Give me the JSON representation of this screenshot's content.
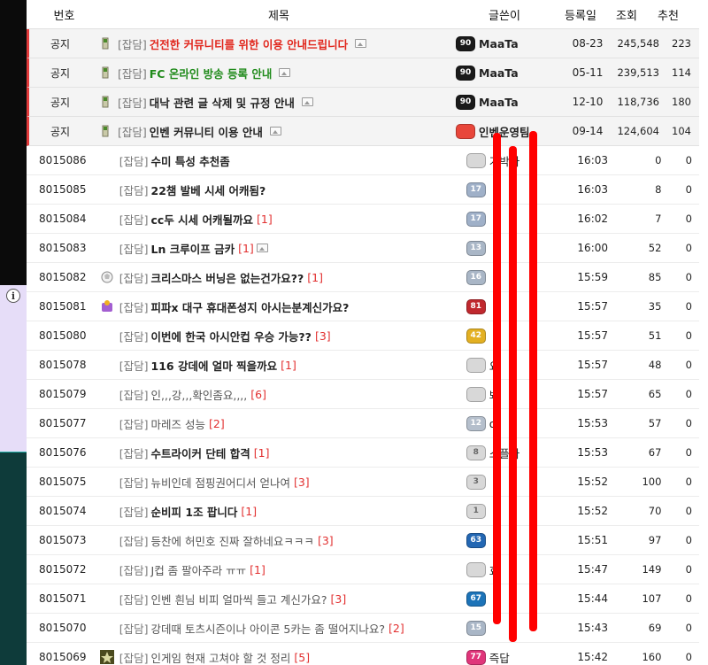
{
  "header": {
    "num": "번호",
    "title": "제목",
    "author": "글쓴이",
    "date": "등록일",
    "views": "조회",
    "recommend": "추천"
  },
  "tag": "[잡담]",
  "notices": [
    {
      "num": "공지",
      "title": "건전한 커뮤니티를 위한 이용 안내드립니다",
      "style": "red",
      "image": true,
      "author": "MaaTa",
      "level": "90",
      "level_color": "#1a1a1a",
      "date": "08-23",
      "views": "245,548",
      "rec": "223"
    },
    {
      "num": "공지",
      "title": "FC 온라인 방송 등록 안내",
      "style": "green",
      "image": true,
      "author": "MaaTa",
      "level": "90",
      "level_color": "#1a1a1a",
      "date": "05-11",
      "views": "239,513",
      "rec": "114"
    },
    {
      "num": "공지",
      "title": "대낙 관련 글 삭제 및 규정 안내",
      "style": "bold",
      "image": true,
      "author": "MaaTa",
      "level": "90",
      "level_color": "#1a1a1a",
      "date": "12-10",
      "views": "118,736",
      "rec": "180"
    },
    {
      "num": "공지",
      "title": "인벤 커뮤니티 이용 안내",
      "style": "bold",
      "image": true,
      "author": "인벤운영팀",
      "level": "",
      "level_color": "#e8463a",
      "date": "09-14",
      "views": "124,604",
      "rec": "104"
    }
  ],
  "posts": [
    {
      "num": "8015086",
      "title": "수미 특성 추천좀",
      "comments": "",
      "image": false,
      "style": "bold",
      "author": "기박사",
      "level": "",
      "level_color": "#d8d8d8",
      "date": "16:03",
      "views": "0",
      "rec": "0"
    },
    {
      "num": "8015085",
      "title": "22챔 발베 시세 어캐됨?",
      "comments": "",
      "image": false,
      "style": "bold",
      "author": "",
      "level": "17",
      "level_color": "#9fb0c8",
      "date": "16:03",
      "views": "8",
      "rec": "0"
    },
    {
      "num": "8015084",
      "title": "cc두 시세 어캐될까요",
      "comments": "[1]",
      "image": false,
      "style": "bold",
      "author": "",
      "level": "17",
      "level_color": "#9fb0c8",
      "date": "16:02",
      "views": "7",
      "rec": "0"
    },
    {
      "num": "8015083",
      "title": "Ln 크루이프 금카",
      "comments": "[1]",
      "image": true,
      "style": "bold",
      "author": "",
      "level": "13",
      "level_color": "#a9b6c6",
      "date": "16:00",
      "views": "52",
      "rec": "0"
    },
    {
      "num": "8015082",
      "title": "크리스마스 버닝은 없는건가요??",
      "comments": "[1]",
      "image": false,
      "style": "bold",
      "author": "",
      "level": "16",
      "level_color": "#a9b6c6",
      "date": "15:59",
      "views": "85",
      "rec": "0",
      "icon": "ball"
    },
    {
      "num": "8015081",
      "title": "피파x 대구 휴대폰성지 아시는분계신가요?",
      "comments": "",
      "image": false,
      "style": "bold",
      "author": "",
      "level": "81",
      "level_color": "#c0282e",
      "date": "15:57",
      "views": "35",
      "rec": "0",
      "icon": "purple"
    },
    {
      "num": "8015080",
      "title": "이번에 한국 아시안컵 우승 가능??",
      "comments": "[3]",
      "image": false,
      "style": "bold",
      "author": "",
      "level": "42",
      "level_color": "#e3b022",
      "date": "15:57",
      "views": "51",
      "rec": "0"
    },
    {
      "num": "8015078",
      "title": "116 강데에 얼마 찍을까요",
      "comments": "[1]",
      "image": false,
      "style": "bold",
      "author": "요",
      "level": "",
      "level_color": "#d8d8d8",
      "date": "15:57",
      "views": "48",
      "rec": "0"
    },
    {
      "num": "8015079",
      "title": "인,,,강,,,확인좀요,,,,",
      "comments": "[6]",
      "image": false,
      "style": "gray",
      "author": "봐",
      "level": "",
      "level_color": "#d8d8d8",
      "date": "15:57",
      "views": "65",
      "rec": "0"
    },
    {
      "num": "8015077",
      "title": "마레즈 성능",
      "comments": "[2]",
      "image": false,
      "style": "gray",
      "author": "o",
      "level": "12",
      "level_color": "#b5bfcc",
      "date": "15:53",
      "views": "57",
      "rec": "0"
    },
    {
      "num": "8015076",
      "title": "수트라이커 단테 합격",
      "comments": "[1]",
      "image": false,
      "style": "bold",
      "author": "스플라",
      "level": "8",
      "level_color": "#d8d8d8",
      "date": "15:53",
      "views": "67",
      "rec": "0"
    },
    {
      "num": "8015075",
      "title": "뉴비인데 점핑권어디서 얻나여",
      "comments": "[3]",
      "image": false,
      "style": "gray",
      "author": "",
      "level": "3",
      "level_color": "#d8d8d8",
      "date": "15:52",
      "views": "100",
      "rec": "0"
    },
    {
      "num": "8015074",
      "title": "순비피 1조 팝니다",
      "comments": "[1]",
      "image": false,
      "style": "bold",
      "author": "",
      "level": "1",
      "level_color": "#d8d8d8",
      "date": "15:52",
      "views": "70",
      "rec": "0"
    },
    {
      "num": "8015073",
      "title": "등찬에 허민호 진짜 잘하네요ㅋㅋㅋ",
      "comments": "[3]",
      "image": false,
      "style": "gray",
      "author": "",
      "level": "63",
      "level_color": "#2367b3",
      "date": "15:51",
      "views": "97",
      "rec": "0"
    },
    {
      "num": "8015072",
      "title": "J컵 좀 팔아주라 ㅠㅠ",
      "comments": "[1]",
      "image": false,
      "style": "gray",
      "author": "효",
      "level": "",
      "level_color": "#d8d8d8",
      "date": "15:47",
      "views": "149",
      "rec": "0"
    },
    {
      "num": "8015071",
      "title": "인벤 흰님 비피 얼마씩 들고 계신가요?",
      "comments": "[3]",
      "image": false,
      "style": "gray",
      "author": "",
      "level": "67",
      "level_color": "#1c73b8",
      "date": "15:44",
      "views": "107",
      "rec": "0"
    },
    {
      "num": "8015070",
      "title": "강데때 토츠시즌이나 아이콘 5카는 좀 떨어지나요?",
      "comments": "[2]",
      "image": false,
      "style": "gray",
      "author": "",
      "level": "15",
      "level_color": "#a9b6c6",
      "date": "15:43",
      "views": "69",
      "rec": "0"
    },
    {
      "num": "8015069",
      "title": "인게임 현재 고쳐야 할 것 정리",
      "comments": "[5]",
      "image": false,
      "style": "gray",
      "author": "즉답",
      "level": "77",
      "level_color": "#e0357a",
      "date": "15:42",
      "views": "160",
      "rec": "0",
      "icon": "army"
    }
  ]
}
